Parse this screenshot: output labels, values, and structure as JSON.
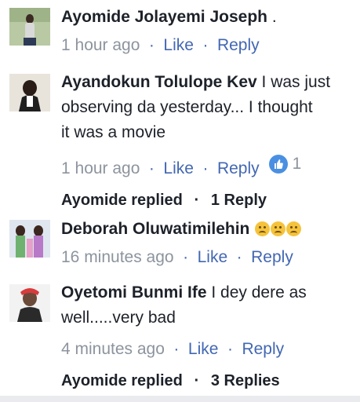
{
  "comments": [
    {
      "author": "Ayomide Jolayemi Joseph",
      "text": " .",
      "time": "1 hour ago",
      "like_label": "Like",
      "reply_label": "Reply"
    },
    {
      "author": "Ayandokun Tolulope Kev",
      "text": " I was just",
      "text_line2": "observing da  yesterday... I thought",
      "text_line3": "it was a movie",
      "time": "1 hour ago",
      "like_label": "Like",
      "reply_label": "Reply",
      "like_count": "1",
      "replied_by": "Ayomide replied",
      "reply_count": "1 Reply"
    },
    {
      "author": "Deborah Oluwatimilehin",
      "reactions": [
        "crying-face",
        "crying-face",
        "crying-face"
      ],
      "time": "16 minutes ago",
      "like_label": "Like",
      "reply_label": "Reply"
    },
    {
      "author": "Oyetomi Bunmi Ife",
      "text": " I dey dere as",
      "text_line2": "well.....very bad",
      "time": "4 minutes ago",
      "like_label": "Like",
      "reply_label": "Reply",
      "replied_by": "Ayomide replied",
      "reply_count": "3 Replies"
    }
  ],
  "separator": "·",
  "colors": {
    "link": "#4267b2",
    "meta": "#8d949e",
    "text": "#1d2129",
    "like_badge": "#4a90e2"
  }
}
